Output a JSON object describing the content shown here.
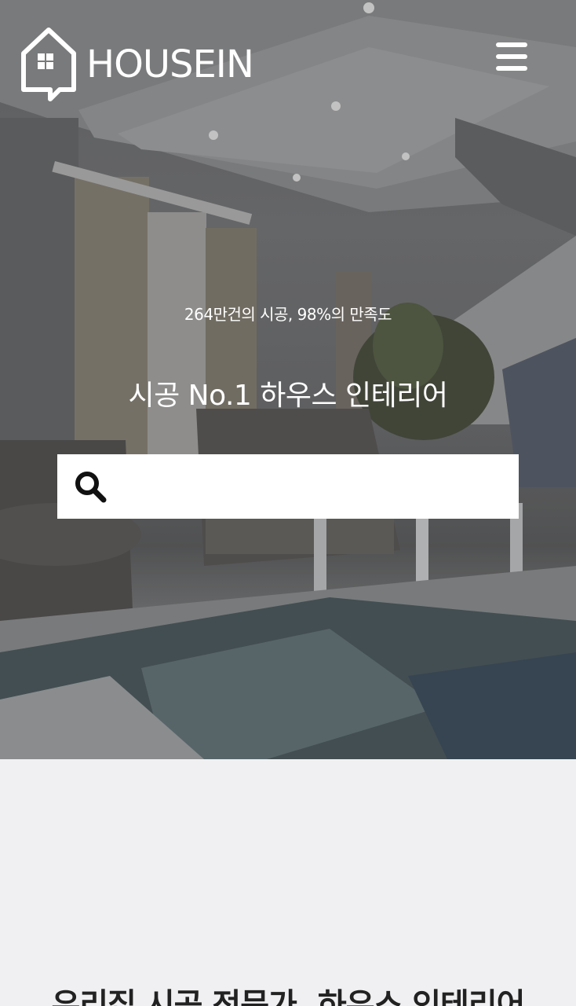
{
  "header": {
    "logo_text": "HOUSEIN",
    "logo_icon": "house-icon",
    "menu_icon": "hamburger-menu-icon"
  },
  "hero": {
    "stats": "264만건의 시공, 98%의 만족도",
    "headline": "시공 No.1 하우스 인테리어",
    "search": {
      "icon": "search-icon",
      "value": "",
      "placeholder": ""
    }
  },
  "section": {
    "title": "우리집 시공 전문가, 하우스 인테리어"
  },
  "colors": {
    "page_background": "#f0f0f2",
    "hero_text": "#ffffff",
    "search_background": "#ffffff",
    "title_text": "#222222"
  }
}
